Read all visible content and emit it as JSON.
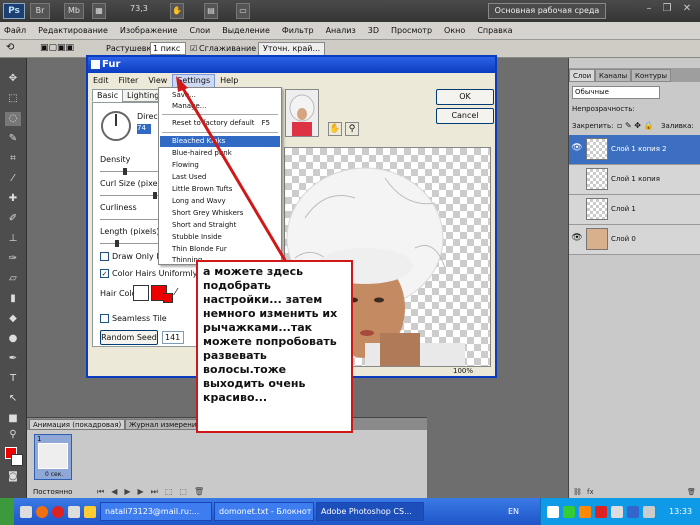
{
  "app": {
    "logo": "Ps",
    "zoom": "73,3",
    "workspace_button": "Основная рабочая среда",
    "toolbar_buttons": [
      "Br",
      "Mb"
    ]
  },
  "menubar": [
    "Файл",
    "Редактирование",
    "Изображение",
    "Слои",
    "Выделение",
    "Фильтр",
    "Анализ",
    "3D",
    "Просмотр",
    "Окно",
    "Справка"
  ],
  "options": {
    "feather_label": "Растушевка:",
    "feather_value": "1 пикс",
    "antialias_label": "Сглаживание",
    "refine_button": "Уточн. край..."
  },
  "layers_panel": {
    "tabs": [
      "Слои",
      "Каналы",
      "Контуры"
    ],
    "blend_mode": "Обычные",
    "opacity_label": "Непрозрачность:",
    "lock_label": "Закрепить:",
    "fill_label": "Заливка:",
    "layers": [
      {
        "name": "Слой 1 копия 2",
        "selected": true,
        "visible": true
      },
      {
        "name": "Слой 1 копия",
        "selected": false,
        "visible": false
      },
      {
        "name": "Слой 1",
        "selected": false,
        "visible": false
      },
      {
        "name": "Слой 0",
        "selected": false,
        "visible": true
      }
    ],
    "footer": "fx"
  },
  "animation_panel": {
    "tabs": [
      "Анимация (покадровая)",
      "Журнал измерений"
    ],
    "frame_number": "1",
    "frame_delay": "0 сек.",
    "loop": "Постоянно"
  },
  "dialog": {
    "title": "Fur",
    "menu": [
      "Edit",
      "Filter",
      "View",
      "Settings",
      "Help"
    ],
    "tabs": [
      "Basic",
      "Lighting"
    ],
    "direction_label": "Direct",
    "direction_value": "74",
    "sliders": [
      "Density",
      "Curl Size (pixels)",
      "Curliness",
      "Length (pixels)"
    ],
    "checkbox_draw_only": "Draw Only Insi",
    "checkbox_color_hairs": "Color Hairs Uniformly",
    "hair_color_label": "Hair Color",
    "checkbox_seamless": "Seamless Tile",
    "random_seed_button": "Random Seed",
    "random_seed_value": "141",
    "ok": "OK",
    "cancel": "Cancel",
    "zoom": "100%"
  },
  "settings_menu": {
    "items": [
      {
        "label": "Save...",
        "key": ""
      },
      {
        "label": "Manage...",
        "key": ""
      },
      {
        "label": "Reset to factory default",
        "key": "F5"
      },
      {
        "label": "Bleached Kinks",
        "key": "",
        "highlight": true
      },
      {
        "label": "Blue-haired punk",
        "key": ""
      },
      {
        "label": "Flowing",
        "key": ""
      },
      {
        "label": "Last Used",
        "key": ""
      },
      {
        "label": "Little Brown Tufts",
        "key": ""
      },
      {
        "label": "Long and Wavy",
        "key": ""
      },
      {
        "label": "Short Grey Whiskers",
        "key": ""
      },
      {
        "label": "Short and Straight",
        "key": ""
      },
      {
        "label": "Stubble Inside",
        "key": ""
      },
      {
        "label": "Thin Blonde Fur",
        "key": ""
      },
      {
        "label": "Thinning",
        "key": ""
      }
    ]
  },
  "annotation": "а можете здесь подобрать настройки... затем немного изменить их рычажками...так можете попробовать развевать волосы.тоже выходить очень красиво...",
  "taskbar": {
    "buttons": [
      "natali73123@mail.ru:...",
      "domonet.txt - Блокнот",
      "Adobe Photoshop CS..."
    ],
    "language": "EN",
    "clock": "13:33"
  },
  "colors": {
    "arrow": "#d01818",
    "selection": "#316ac5",
    "foreground": "#e00000"
  }
}
